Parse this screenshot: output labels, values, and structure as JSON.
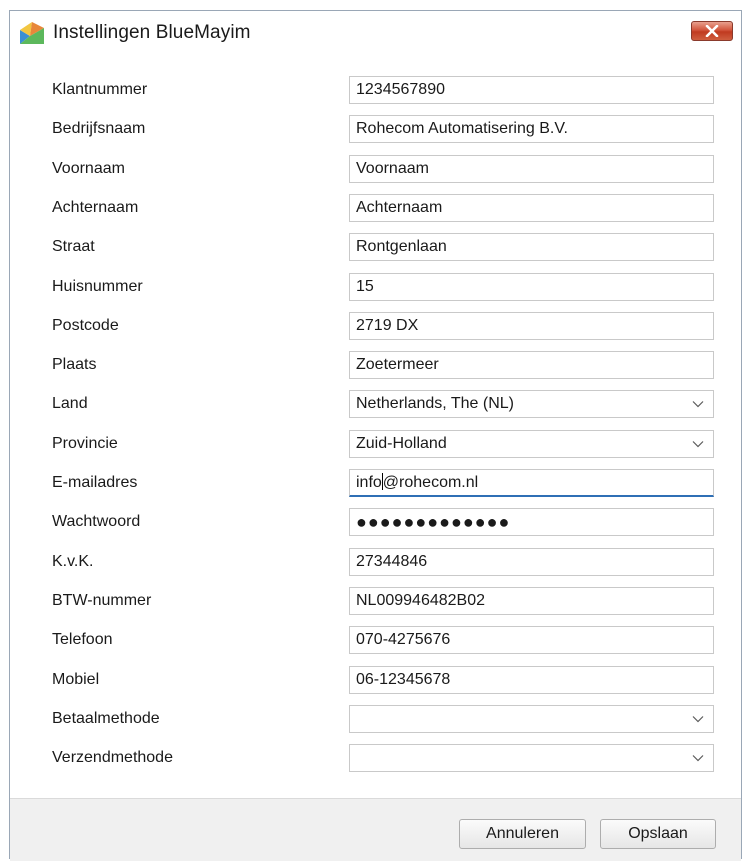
{
  "window": {
    "title": "Instellingen BlueMayim"
  },
  "fields": [
    {
      "label": "Klantnummer",
      "value": "1234567890",
      "type": "text"
    },
    {
      "label": "Bedrijfsnaam",
      "value": "Rohecom Automatisering B.V.",
      "type": "text"
    },
    {
      "label": "Voornaam",
      "value": "Voornaam",
      "type": "text"
    },
    {
      "label": "Achternaam",
      "value": "Achternaam",
      "type": "text"
    },
    {
      "label": "Straat",
      "value": "Rontgenlaan",
      "type": "text"
    },
    {
      "label": "Huisnummer",
      "value": "15",
      "type": "text"
    },
    {
      "label": "Postcode",
      "value": "2719 DX",
      "type": "text"
    },
    {
      "label": "Plaats",
      "value": "Zoetermeer",
      "type": "text"
    },
    {
      "label": "Land",
      "value": "Netherlands, The (NL)",
      "type": "select"
    },
    {
      "label": "Provincie",
      "value": "Zuid-Holland",
      "type": "select"
    },
    {
      "label": "E-mailadres",
      "value": "info@rohecom.nl",
      "type": "focused",
      "before": "info",
      "after": "@rohecom.nl"
    },
    {
      "label": "Wachtwoord",
      "value": "●●●●●●●●●●●●●",
      "type": "password"
    },
    {
      "label": "K.v.K.",
      "value": "27344846",
      "type": "text"
    },
    {
      "label": "BTW-nummer",
      "value": "NL009946482B02",
      "type": "text"
    },
    {
      "label": "Telefoon",
      "value": "070-4275676",
      "type": "text"
    },
    {
      "label": "Mobiel",
      "value": "06-12345678",
      "type": "text"
    },
    {
      "label": "Betaalmethode",
      "value": "",
      "type": "select"
    },
    {
      "label": "Verzendmethode",
      "value": "",
      "type": "select"
    }
  ],
  "footer": {
    "cancel_label": "Annuleren",
    "save_label": "Opslaan"
  },
  "colors": {
    "focus_underline": "#2f6fb5",
    "close_button": "#c03a20"
  }
}
